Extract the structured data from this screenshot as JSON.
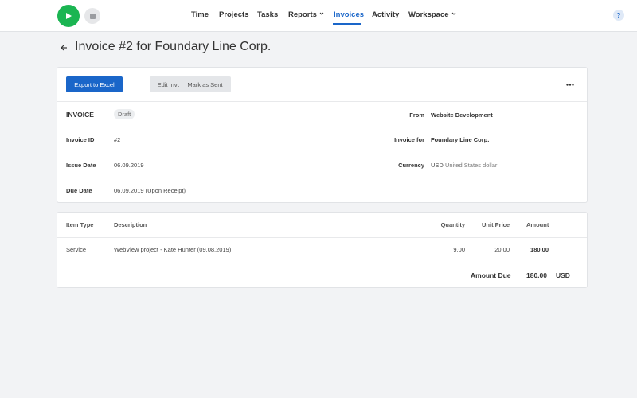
{
  "nav": {
    "items": [
      {
        "label": "Time",
        "active": false,
        "dropdown": false
      },
      {
        "label": "Projects",
        "active": false,
        "dropdown": false
      },
      {
        "label": "Tasks",
        "active": false,
        "dropdown": false
      },
      {
        "label": "Reports",
        "active": false,
        "dropdown": true
      },
      {
        "label": "Invoices",
        "active": true,
        "dropdown": false
      },
      {
        "label": "Activity",
        "active": false,
        "dropdown": false
      },
      {
        "label": "Workspace",
        "active": false,
        "dropdown": true
      }
    ],
    "help_label": "?",
    "play_icon": "play-icon",
    "stop_icon": "stop-icon"
  },
  "page": {
    "title": "Invoice #2 for Foundary Line Corp."
  },
  "toolbar": {
    "export_label": "Export to Excel",
    "edit_label": "Edit Invoice",
    "sent_label": "Mark as Sent",
    "more_icon": "more-horizontal-icon"
  },
  "invoice": {
    "heading": "INVOICE",
    "status": "Draft",
    "id_label": "Invoice ID",
    "id_value": "#2",
    "issue_label": "Issue Date",
    "issue_value": "06.09.2019",
    "due_label": "Due Date",
    "due_value": "06.09.2019 (Upon Receipt)",
    "from_label": "From",
    "from_value": "Website Development",
    "for_label": "Invoice for",
    "for_value": "Foundary Line Corp.",
    "currency_label": "Currency",
    "currency_code": "USD",
    "currency_name": "United States dollar"
  },
  "items": {
    "headers": {
      "type": "Item Type",
      "description": "Description",
      "quantity": "Quantity",
      "unit_price": "Unit Price",
      "amount": "Amount"
    },
    "rows": [
      {
        "type": "Service",
        "description": "WebView project - Kate Hunter (09.08.2019)",
        "quantity": "9.00",
        "unit_price": "20.00",
        "amount": "180.00"
      }
    ],
    "amount_due_label": "Amount Due",
    "amount_due_value": "180.00",
    "amount_due_currency": "USD"
  },
  "colors": {
    "accent": "#1a66c9",
    "play": "#1bb552",
    "background": "#f2f3f5"
  }
}
